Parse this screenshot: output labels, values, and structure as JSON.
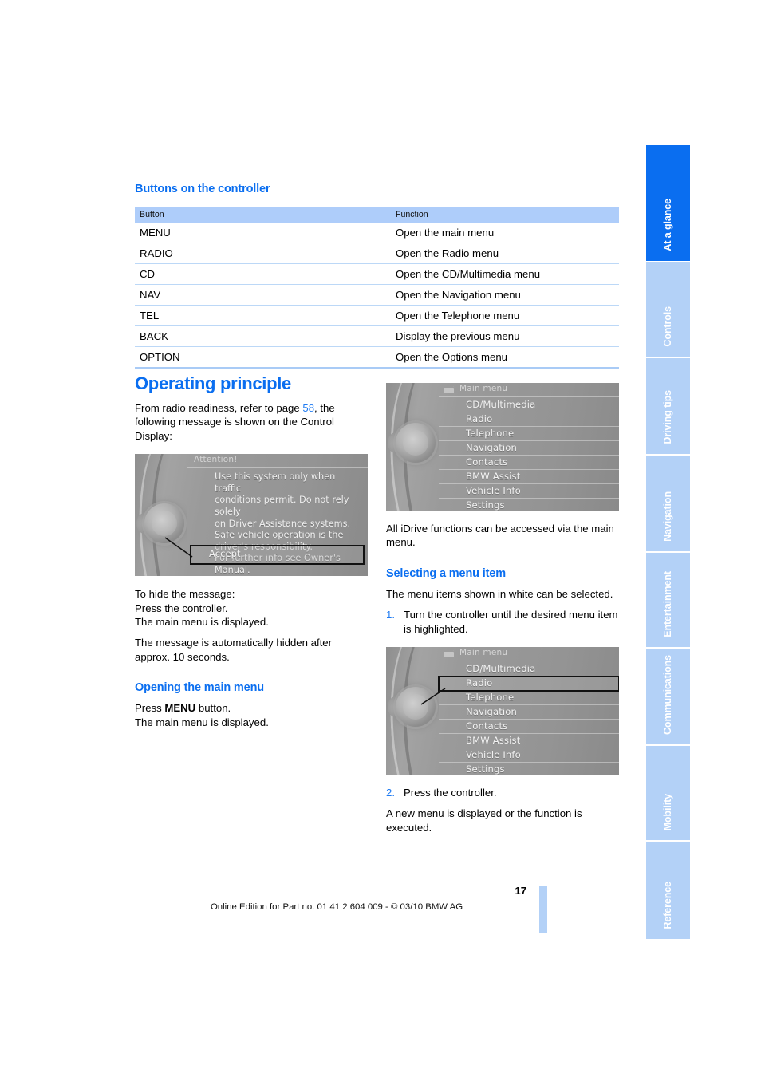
{
  "sections": {
    "buttons_heading": "Buttons on the controller",
    "operating_heading": "Operating principle",
    "opening_heading": "Opening the main menu",
    "selecting_heading": "Selecting a menu item"
  },
  "table": {
    "headers": [
      "Button",
      "Function"
    ],
    "rows": [
      [
        "MENU",
        "Open the main menu"
      ],
      [
        "RADIO",
        "Open the Radio menu"
      ],
      [
        "CD",
        "Open the CD/Multimedia menu"
      ],
      [
        "NAV",
        "Open the Navigation menu"
      ],
      [
        "TEL",
        "Open the Telephone menu"
      ],
      [
        "BACK",
        "Display the previous menu"
      ],
      [
        "OPTION",
        "Open the Options menu"
      ]
    ]
  },
  "left_column": {
    "intro_part1": "From radio readiness, refer to page ",
    "intro_page_ref": "58",
    "intro_part2": ", the following message is shown on the Control Display:",
    "hide_line1": "To hide the message:",
    "hide_line2": "Press the controller.",
    "hide_line3": "The main menu is displayed.",
    "auto_hide": "The message is automatically hidden after approx. 10 seconds.",
    "open_line1_pre": "Press ",
    "open_line1_key": "MENU",
    "open_line1_post": " button.",
    "open_line2": "The main menu is displayed."
  },
  "right_column": {
    "all_functions": "All iDrive functions can be accessed via the main menu.",
    "white_items": "The menu items shown in white can be selected.",
    "step1_num": "1.",
    "step1_text": "Turn the controller until the desired menu item is highlighted.",
    "step2_num": "2.",
    "step2_text": "Press the controller.",
    "after_step2": "A new menu is displayed or the function is executed."
  },
  "idrive_attention": {
    "title": "Attention!",
    "message_lines": [
      "Use this system only when traffic",
      "conditions permit. Do not rely solely",
      "on Driver Assistance systems.",
      "Safe vehicle operation is the",
      "driver's responsibility.",
      "For further info see Owner's Manual."
    ],
    "button": "Accept"
  },
  "idrive_main_menu": {
    "title": "Main menu",
    "items": [
      "CD/Multimedia",
      "Radio",
      "Telephone",
      "Navigation",
      "Contacts",
      "BMW Assist",
      "Vehicle Info",
      "Settings"
    ],
    "selected": null
  },
  "idrive_main_menu_selected": {
    "title": "Main menu",
    "items": [
      "CD/Multimedia",
      "Radio",
      "Telephone",
      "Navigation",
      "Contacts",
      "BMW Assist",
      "Vehicle Info",
      "Settings"
    ],
    "selected": "Radio"
  },
  "tabs": [
    {
      "label": "At a glance",
      "active": true
    },
    {
      "label": "Controls",
      "active": false
    },
    {
      "label": "Driving tips",
      "active": false
    },
    {
      "label": "Navigation",
      "active": false
    },
    {
      "label": "Entertainment",
      "active": false
    },
    {
      "label": "Communications",
      "active": false
    },
    {
      "label": "Mobility",
      "active": false
    },
    {
      "label": "Reference",
      "active": false
    }
  ],
  "footer": {
    "page_number": "17",
    "text": "Online Edition for Part no. 01 41 2 604 009 - © 03/10 BMW AG"
  },
  "colors": {
    "accent_blue": "#0a6ef0",
    "tab_idle_blue": "#b3d1f7",
    "table_header_blue": "#aecdfa",
    "table_rule_blue": "#bcd8f7"
  }
}
